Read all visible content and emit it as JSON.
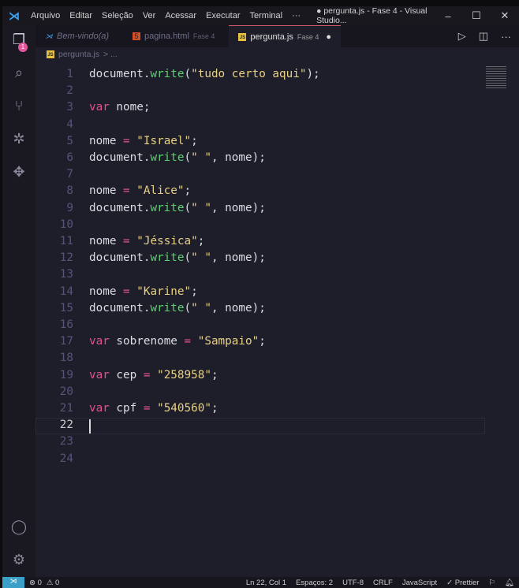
{
  "titlebar": {
    "menus": [
      "Arquivo",
      "Editar",
      "Seleção",
      "Ver",
      "Acessar",
      "Executar",
      "Terminal",
      "···"
    ],
    "title": "● pergunta.js - Fase 4 - Visual Studio..."
  },
  "activity": {
    "badge": "1"
  },
  "tabs": [
    {
      "label": "Bem-vindo(a)",
      "sub": "",
      "icon": "vscode-icon"
    },
    {
      "label": "pagina.html",
      "sub": "Fase 4",
      "icon": "html-icon"
    },
    {
      "label": "pergunta.js",
      "sub": "Fase 4",
      "icon": "js-icon",
      "dirty": "●"
    }
  ],
  "breadcrumb": {
    "file": "pergunta.js",
    "sep": "> ..."
  },
  "editor": {
    "current_line": 22,
    "lines": [
      [
        [
          "p",
          "document."
        ],
        [
          "fn",
          "write"
        ],
        [
          "p",
          "("
        ],
        [
          "st",
          "\"tudo certo aqui\""
        ],
        [
          "p",
          ");"
        ]
      ],
      [],
      [
        [
          "kw",
          "var"
        ],
        [
          "p",
          " nome;"
        ]
      ],
      [],
      [
        [
          "p",
          "nome "
        ],
        [
          "op",
          "="
        ],
        [
          "p",
          " "
        ],
        [
          "st",
          "\"Israel\""
        ],
        [
          "p",
          ";"
        ]
      ],
      [
        [
          "p",
          "document."
        ],
        [
          "fn",
          "write"
        ],
        [
          "p",
          "("
        ],
        [
          "st",
          "\" \""
        ],
        [
          "p",
          ", nome);"
        ]
      ],
      [],
      [
        [
          "p",
          "nome "
        ],
        [
          "op",
          "="
        ],
        [
          "p",
          " "
        ],
        [
          "st",
          "\"Alice\""
        ],
        [
          "p",
          ";"
        ]
      ],
      [
        [
          "p",
          "document."
        ],
        [
          "fn",
          "write"
        ],
        [
          "p",
          "("
        ],
        [
          "st",
          "\" \""
        ],
        [
          "p",
          ", nome);"
        ]
      ],
      [],
      [
        [
          "p",
          "nome "
        ],
        [
          "op",
          "="
        ],
        [
          "p",
          " "
        ],
        [
          "st",
          "\"Jéssica\""
        ],
        [
          "p",
          ";"
        ]
      ],
      [
        [
          "p",
          "document."
        ],
        [
          "fn",
          "write"
        ],
        [
          "p",
          "("
        ],
        [
          "st",
          "\" \""
        ],
        [
          "p",
          ", nome);"
        ]
      ],
      [],
      [
        [
          "p",
          "nome "
        ],
        [
          "op",
          "="
        ],
        [
          "p",
          " "
        ],
        [
          "st",
          "\"Karine\""
        ],
        [
          "p",
          ";"
        ]
      ],
      [
        [
          "p",
          "document."
        ],
        [
          "fn",
          "write"
        ],
        [
          "p",
          "("
        ],
        [
          "st",
          "\" \""
        ],
        [
          "p",
          ", nome);"
        ]
      ],
      [],
      [
        [
          "kw",
          "var"
        ],
        [
          "p",
          " sobrenome "
        ],
        [
          "op",
          "="
        ],
        [
          "p",
          " "
        ],
        [
          "st",
          "\"Sampaio\""
        ],
        [
          "p",
          ";"
        ]
      ],
      [],
      [
        [
          "kw",
          "var"
        ],
        [
          "p",
          " cep "
        ],
        [
          "op",
          "="
        ],
        [
          "p",
          " "
        ],
        [
          "st",
          "\"258958\""
        ],
        [
          "p",
          ";"
        ]
      ],
      [],
      [
        [
          "kw",
          "var"
        ],
        [
          "p",
          " cpf "
        ],
        [
          "op",
          "="
        ],
        [
          "p",
          " "
        ],
        [
          "st",
          "\"540560\""
        ],
        [
          "p",
          ";"
        ]
      ],
      [],
      [],
      []
    ]
  },
  "status": {
    "errors": "⊗ 0",
    "warnings": "⚠ 0",
    "position": "Ln 22, Col 1",
    "spaces": "Espaços: 2",
    "encoding": "UTF-8",
    "eol": "CRLF",
    "language": "JavaScript",
    "prettier": "✓ Prettier"
  }
}
